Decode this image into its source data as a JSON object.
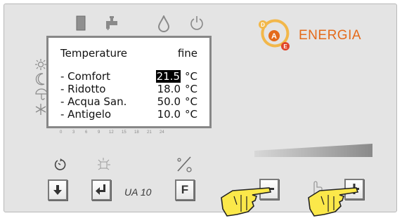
{
  "display": {
    "title": "Temperature",
    "status": "fine",
    "rows": [
      {
        "label": "- Comfort",
        "value": "21.5",
        "unit": "°C"
      },
      {
        "label": "- Ridotto",
        "value": "18.0",
        "unit": "°C"
      },
      {
        "label": "- Acqua San.",
        "value": "50.0",
        "unit": "°C"
      },
      {
        "label": "- Antigelo",
        "value": "10.0",
        "unit": "°C"
      }
    ],
    "selected_row": 0
  },
  "time_scale": [
    "0",
    "3",
    "6",
    "9",
    "12",
    "15",
    "18",
    "21",
    "24"
  ],
  "top_icons": [
    "book-icon",
    "faucet-icon",
    "water-drop-icon",
    "power-icon"
  ],
  "side_icons": [
    "sun-icon",
    "moon-icon",
    "umbrella-icon",
    "snowflake-icon"
  ],
  "buttons": {
    "f_label": "F",
    "model": "UA 10"
  },
  "logo": {
    "text": "ENERGIA",
    "letters": [
      "D",
      "A",
      "E"
    ]
  },
  "colors": {
    "accent": "#e46a1a",
    "panel": "#e4e4e4",
    "lcd_border": "#878787"
  }
}
